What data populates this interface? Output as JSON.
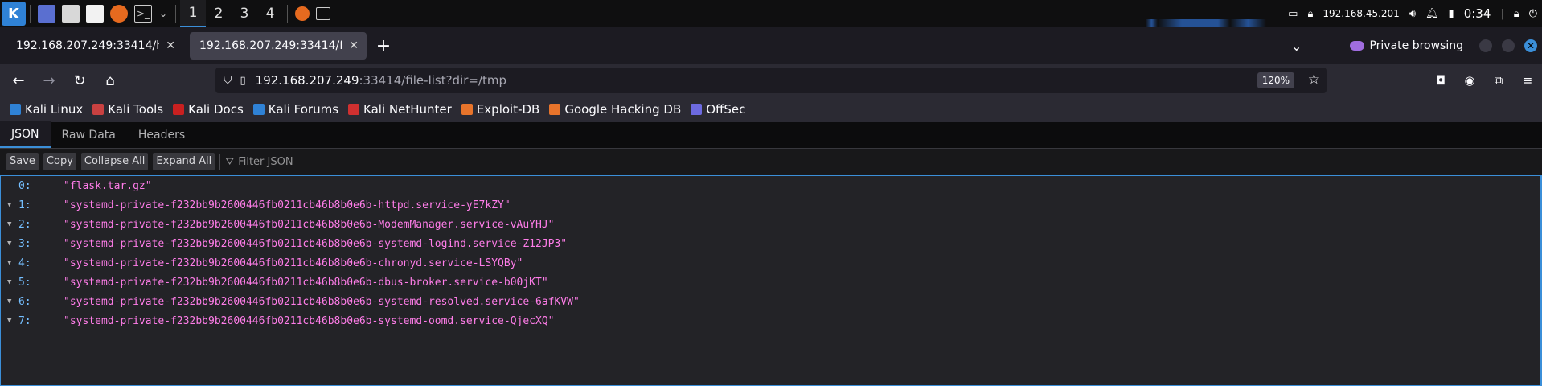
{
  "taskbar": {
    "workspaces": [
      "1",
      "2",
      "3",
      "4"
    ],
    "ip": "192.168.45.201",
    "clock": "0:34"
  },
  "tabs": [
    {
      "title": "192.168.207.249:33414/h",
      "active": false
    },
    {
      "title": "192.168.207.249:33414/fil",
      "active": true
    }
  ],
  "private_label": "Private browsing",
  "url": {
    "host": "192.168.207.249",
    "rest": ":33414/file-list?dir=/tmp",
    "zoom": "120%"
  },
  "bookmarks": [
    {
      "label": "Kali Linux",
      "icon": "kali-icon",
      "color": "#2f82d6"
    },
    {
      "label": "Kali Tools",
      "icon": "kali-tools-icon",
      "color": "#c94141"
    },
    {
      "label": "Kali Docs",
      "icon": "kali-docs-icon",
      "color": "#c92020"
    },
    {
      "label": "Kali Forums",
      "icon": "kali-forums-icon",
      "color": "#2f82d6"
    },
    {
      "label": "Kali NetHunter",
      "icon": "nethunter-icon",
      "color": "#d03030"
    },
    {
      "label": "Exploit-DB",
      "icon": "exploitdb-icon",
      "color": "#e8742b"
    },
    {
      "label": "Google Hacking DB",
      "icon": "ghdb-icon",
      "color": "#e8742b"
    },
    {
      "label": "OffSec",
      "icon": "offsec-icon",
      "color": "#6d6ae0"
    }
  ],
  "viewer": {
    "tabs": [
      "JSON",
      "Raw Data",
      "Headers"
    ],
    "buttons": [
      "Save",
      "Copy",
      "Collapse All",
      "Expand All"
    ],
    "filter_placeholder": "Filter JSON"
  },
  "json_rows": [
    {
      "key": "0:",
      "value": "\"flask.tar.gz\"",
      "toggle": false
    },
    {
      "key": "1:",
      "value": "\"systemd-private-f232bb9b2600446fb0211cb46b8b0e6b-httpd.service-yE7kZY\"",
      "toggle": true
    },
    {
      "key": "2:",
      "value": "\"systemd-private-f232bb9b2600446fb0211cb46b8b0e6b-ModemManager.service-vAuYHJ\"",
      "toggle": true
    },
    {
      "key": "3:",
      "value": "\"systemd-private-f232bb9b2600446fb0211cb46b8b0e6b-systemd-logind.service-Z12JP3\"",
      "toggle": true
    },
    {
      "key": "4:",
      "value": "\"systemd-private-f232bb9b2600446fb0211cb46b8b0e6b-chronyd.service-LSYQBy\"",
      "toggle": true
    },
    {
      "key": "5:",
      "value": "\"systemd-private-f232bb9b2600446fb0211cb46b8b0e6b-dbus-broker.service-b00jKT\"",
      "toggle": true
    },
    {
      "key": "6:",
      "value": "\"systemd-private-f232bb9b2600446fb0211cb46b8b0e6b-systemd-resolved.service-6afKVW\"",
      "toggle": true
    },
    {
      "key": "7:",
      "value": "\"systemd-private-f232bb9b2600446fb0211cb46b8b0e6b-systemd-oomd.service-QjecXQ\"",
      "toggle": true
    }
  ]
}
